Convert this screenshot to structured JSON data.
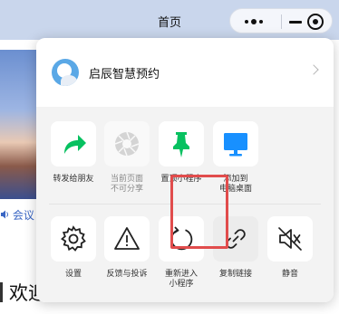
{
  "page": {
    "title": "首页",
    "notice_fragment": "会议",
    "welcome_fragment": "欢迎"
  },
  "capsule": {
    "more": "more-icon",
    "minimize": "minimize-icon",
    "close": "close-target-icon"
  },
  "panel": {
    "app_name": "启辰智慧预约",
    "row1": [
      {
        "label": "转发给朋友",
        "icon": "share-arrow-icon",
        "color": "#07c160",
        "enabled": true
      },
      {
        "label": "当前页面\n不可分享",
        "icon": "aperture-icon",
        "color": "#c8c8c8",
        "enabled": false
      },
      {
        "label": "置顶小程序",
        "icon": "pin-icon",
        "color": "#07c160",
        "enabled": true
      },
      {
        "label": "添加到\n电脑桌面",
        "icon": "monitor-icon",
        "color": "#1890ff",
        "enabled": true
      }
    ],
    "row2": [
      {
        "label": "设置",
        "icon": "gear-icon",
        "enabled": true
      },
      {
        "label": "反馈与投诉",
        "icon": "warning-icon",
        "enabled": true
      },
      {
        "label": "重新进入\n小程序",
        "icon": "refresh-icon",
        "enabled": true
      },
      {
        "label": "复制链接",
        "icon": "link-icon",
        "enabled": true,
        "highlighted": true
      },
      {
        "label": "静音",
        "icon": "speaker-mute-icon",
        "enabled": true
      }
    ]
  },
  "colors": {
    "accent_green": "#07c160",
    "accent_blue": "#1890ff",
    "highlight_red": "#e14c4c",
    "nav_bg": "#c9d6ec"
  }
}
